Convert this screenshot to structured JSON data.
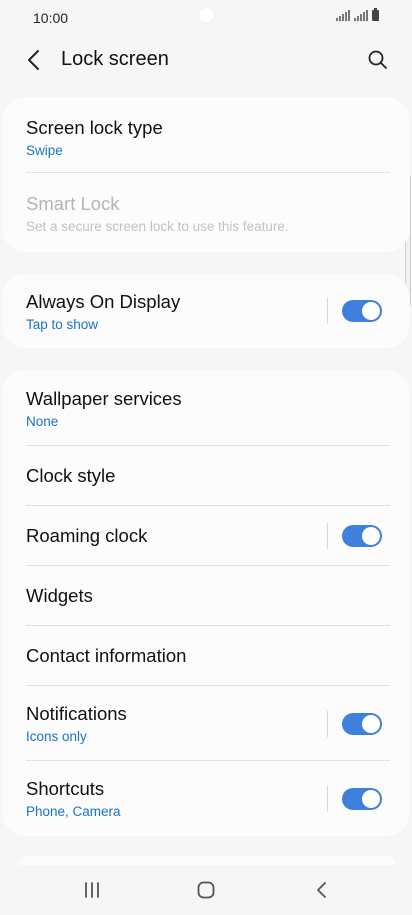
{
  "status_bar": {
    "time": "10:00"
  },
  "header": {
    "title": "Lock screen"
  },
  "group1": [
    {
      "title": "Screen lock type",
      "subtitle": "Swipe"
    },
    {
      "title": "Smart Lock",
      "subtitle": "Set a secure screen lock to use this feature.",
      "disabled": true
    }
  ],
  "group2": [
    {
      "title": "Always On Display",
      "subtitle": "Tap to show",
      "toggle_on": true
    }
  ],
  "group3": [
    {
      "title": "Wallpaper services",
      "subtitle": "None"
    },
    {
      "title": "Clock style"
    },
    {
      "title": "Roaming clock",
      "toggle_on": true
    },
    {
      "title": "Widgets"
    },
    {
      "title": "Contact information"
    },
    {
      "title": "Notifications",
      "subtitle": "Icons only",
      "toggle_on": true
    },
    {
      "title": "Shortcuts",
      "subtitle": "Phone, Camera",
      "toggle_on": true
    }
  ],
  "colors": {
    "accent": "#3e80dc",
    "subtitle": "#1a73c4",
    "background": "#f6f6f6"
  },
  "icons": {
    "back": "chevron-left-icon",
    "search": "search-icon",
    "nav_recents": "recents-icon",
    "nav_home": "home-icon",
    "nav_back": "back-icon"
  }
}
